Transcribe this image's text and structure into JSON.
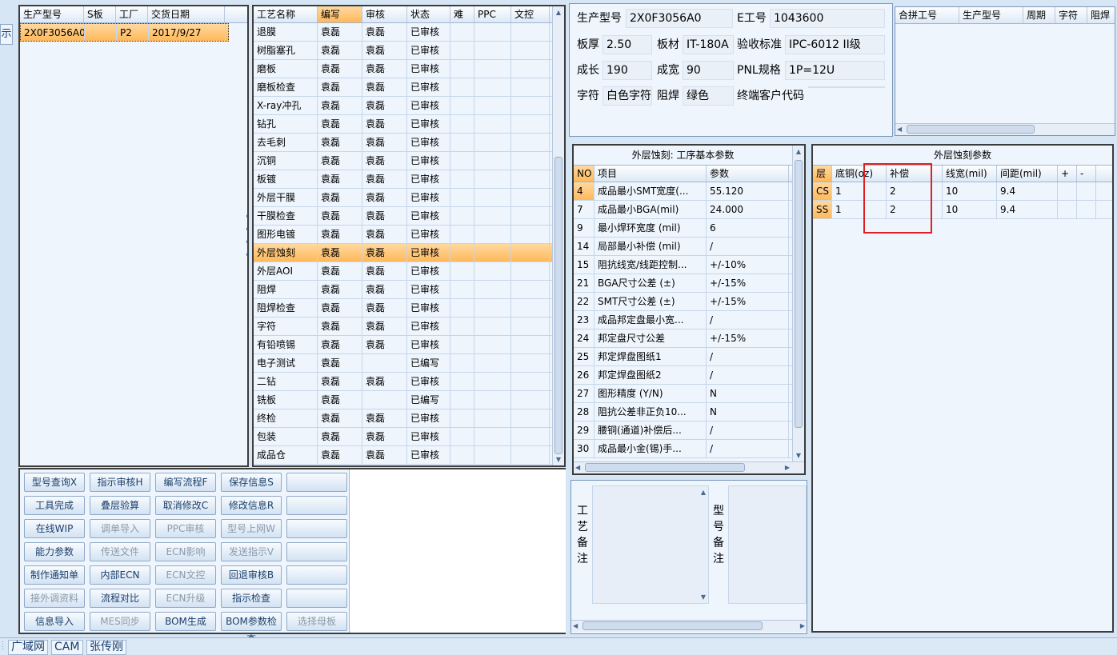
{
  "side_tab": "示",
  "order_table": {
    "headers": [
      "生产型号",
      "S板",
      "工厂",
      "交货日期"
    ],
    "rows": [
      [
        "2X0F3056A0",
        "",
        "P2",
        "2017/9/27"
      ]
    ]
  },
  "process_table": {
    "headers": [
      "工艺名称",
      "编写",
      "审核",
      "状态",
      "难",
      "PPC",
      "文控"
    ],
    "rows": [
      [
        "退膜",
        "袁磊",
        "袁磊",
        "已审核"
      ],
      [
        "树脂塞孔",
        "袁磊",
        "袁磊",
        "已审核"
      ],
      [
        "磨板",
        "袁磊",
        "袁磊",
        "已审核"
      ],
      [
        "磨板检查",
        "袁磊",
        "袁磊",
        "已审核"
      ],
      [
        "X-ray冲孔",
        "袁磊",
        "袁磊",
        "已审核"
      ],
      [
        "钻孔",
        "袁磊",
        "袁磊",
        "已审核"
      ],
      [
        "去毛刺",
        "袁磊",
        "袁磊",
        "已审核"
      ],
      [
        "沉铜",
        "袁磊",
        "袁磊",
        "已审核"
      ],
      [
        "板镀",
        "袁磊",
        "袁磊",
        "已审核"
      ],
      [
        "外层干膜",
        "袁磊",
        "袁磊",
        "已审核"
      ],
      [
        "干膜检查",
        "袁磊",
        "袁磊",
        "已审核"
      ],
      [
        "图形电镀",
        "袁磊",
        "袁磊",
        "已审核"
      ],
      [
        "外层蚀刻",
        "袁磊",
        "袁磊",
        "已审核"
      ],
      [
        "外层AOI",
        "袁磊",
        "袁磊",
        "已审核"
      ],
      [
        "阻焊",
        "袁磊",
        "袁磊",
        "已审核"
      ],
      [
        "阻焊检查",
        "袁磊",
        "袁磊",
        "已审核"
      ],
      [
        "字符",
        "袁磊",
        "袁磊",
        "已审核"
      ],
      [
        "有铅喷锡",
        "袁磊",
        "袁磊",
        "已审核"
      ],
      [
        "电子测试",
        "袁磊",
        "",
        "已编写"
      ],
      [
        "二钻",
        "袁磊",
        "袁磊",
        "已审核"
      ],
      [
        "铣板",
        "袁磊",
        "",
        "已编写"
      ],
      [
        "终检",
        "袁磊",
        "袁磊",
        "已审核"
      ],
      [
        "包装",
        "袁磊",
        "袁磊",
        "已审核"
      ],
      [
        "成品仓",
        "袁磊",
        "袁磊",
        "已审核"
      ]
    ],
    "selected_index": 12
  },
  "buttons": [
    [
      "型号查询X",
      "指示审核H",
      "编写流程F",
      "保存信息S",
      ""
    ],
    [
      "工具完成",
      "叠层验算",
      "取消修改C",
      "修改信息R",
      ""
    ],
    [
      "在线WIP",
      "调单导入",
      "PPC审核",
      "型号上网W",
      ""
    ],
    [
      "能力参数",
      "传送文件",
      "ECN影响",
      "发送指示V",
      ""
    ],
    [
      "制作通知单",
      "内部ECN",
      "ECN文控",
      "回退审核B",
      ""
    ],
    [
      "接外调资料",
      "流程对比",
      "ECN升级",
      "指示检查",
      ""
    ],
    [
      "信息导入",
      "MES同步",
      "BOM生成",
      "BOM参数检查",
      "选择母板"
    ]
  ],
  "buttons_disabled": [
    [
      false,
      false,
      false,
      false,
      false
    ],
    [
      false,
      false,
      false,
      false,
      false
    ],
    [
      false,
      true,
      true,
      true,
      false
    ],
    [
      false,
      true,
      true,
      true,
      false
    ],
    [
      false,
      false,
      true,
      false,
      false
    ],
    [
      true,
      false,
      true,
      false,
      false
    ],
    [
      false,
      true,
      false,
      false,
      true
    ]
  ],
  "info": {
    "model_label": "生产型号",
    "model": "2X0F3056A0",
    "eno_label": "E工号",
    "eno": "1043600",
    "thickness_label": "板厚",
    "thickness": "2.50",
    "material_label": "板材",
    "material": "IT-180A",
    "standard_label": "验收标准",
    "standard": "IPC-6012 II级",
    "length_label": "成长",
    "length": "190",
    "width_label": "成宽",
    "width": "90",
    "pnl_label": "PNL规格",
    "pnl": "1P=12U",
    "char_label": "字符",
    "char": "白色字符",
    "mask_label": "阻焊",
    "mask": "绿色",
    "customer_label": "终端客户代码",
    "customer": ""
  },
  "merge_table": {
    "headers": [
      "合拼工号",
      "生产型号",
      "周期",
      "字符",
      "阻焊"
    ]
  },
  "basic_params": {
    "title": "外层蚀刻: 工序基本参数",
    "headers": [
      "NO",
      "项目",
      "参数"
    ],
    "rows": [
      [
        "4",
        "成品最小SMT宽度(...",
        "55.120"
      ],
      [
        "7",
        "成品最小BGA(mil)",
        "24.000"
      ],
      [
        "9",
        "最小焊环宽度 (mil)",
        "6"
      ],
      [
        "14",
        "局部最小补偿 (mil)",
        "/"
      ],
      [
        "15",
        "阻抗线宽/线距控制...",
        "+/-10%"
      ],
      [
        "21",
        "BGA尺寸公差 (±)",
        "+/-15%"
      ],
      [
        "22",
        "SMT尺寸公差 (±)",
        "+/-15%"
      ],
      [
        "23",
        "成品邦定盘最小宽...",
        "/"
      ],
      [
        "24",
        "邦定盘尺寸公差",
        "+/-15%"
      ],
      [
        "25",
        "邦定焊盘图纸1",
        "/"
      ],
      [
        "26",
        "邦定焊盘图纸2",
        "/"
      ],
      [
        "27",
        "图形精度 (Y/N)",
        "N"
      ],
      [
        "28",
        "阻抗公差非正负10...",
        "N"
      ],
      [
        "29",
        "腰铜(通道)补偿后...",
        "/"
      ],
      [
        "30",
        "成品最小金(锡)手...",
        "/"
      ]
    ]
  },
  "etch_params": {
    "title": "外层蚀刻参数",
    "headers": [
      "层",
      "底铜(oz)",
      "补偿",
      "线宽(mil)",
      "间距(mil)",
      "+",
      "-"
    ],
    "rows": [
      [
        "CS",
        "1",
        "2",
        "10",
        "9.4",
        "",
        ""
      ],
      [
        "SS",
        "1",
        "2",
        "10",
        "9.4",
        "",
        ""
      ]
    ]
  },
  "remarks": {
    "process_label": "工艺备注",
    "model_label": "型号备注"
  },
  "status_tabs": [
    "广域网",
    "CAM",
    "张传刚"
  ],
  "colors": {
    "selected_row": "#ffc070",
    "highlight_box": "#e02020"
  }
}
